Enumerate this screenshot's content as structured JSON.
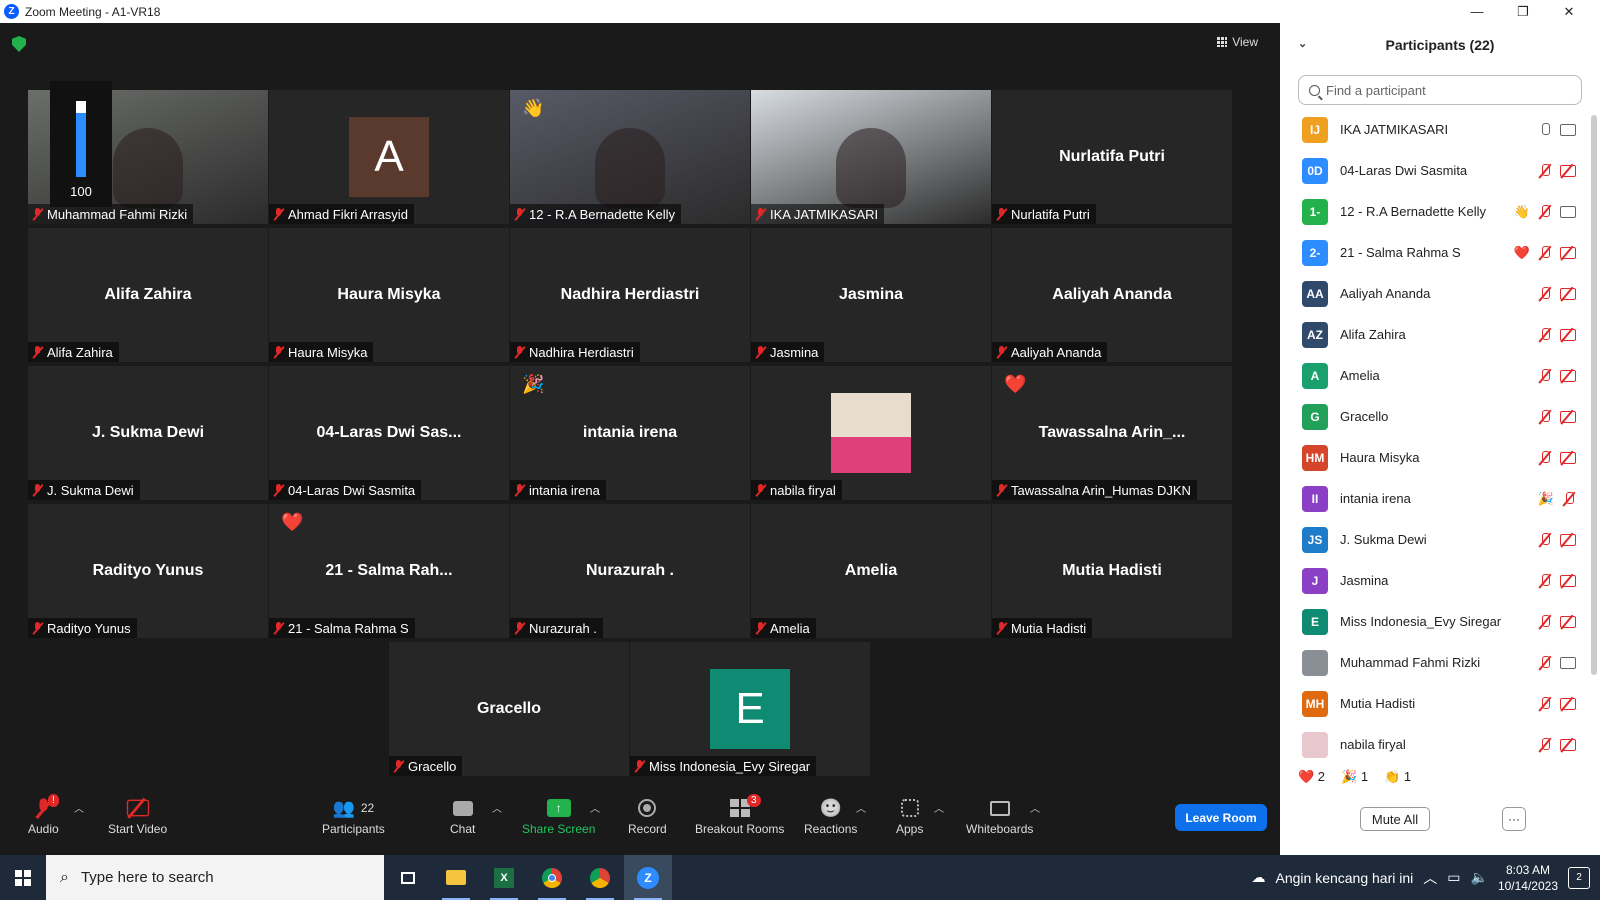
{
  "window": {
    "title": "Zoom Meeting - A1-VR18",
    "logo_letter": "Z"
  },
  "meeting": {
    "view_label": "View",
    "volume_level": "100",
    "tiles": [
      {
        "big": "",
        "label": "Muhammad Fahmi Rizki",
        "kind": "video",
        "bg": "#6b6e6a"
      },
      {
        "big": "A",
        "label": "Ahmad Fikri Arrasyid",
        "kind": "avatar",
        "bg": "#5b3a2e"
      },
      {
        "big": "",
        "label": "12 - R.A Bernadette Kelly",
        "kind": "video",
        "bg": "#585a66",
        "reaction": "👋"
      },
      {
        "big": "",
        "label": "IKA JATMIKASARI",
        "kind": "video",
        "bg": "#d8dde2",
        "active": true
      },
      {
        "big": "Nurlatifa Putri",
        "label": "Nurlatifa Putri",
        "kind": "name"
      },
      {
        "big": "Alifa Zahira",
        "label": "Alifa Zahira",
        "kind": "name"
      },
      {
        "big": "Haura Misyka",
        "label": "Haura Misyka",
        "kind": "name"
      },
      {
        "big": "Nadhira Herdiastri",
        "label": "Nadhira Herdiastri",
        "kind": "name"
      },
      {
        "big": "Jasmina",
        "label": "Jasmina",
        "kind": "name"
      },
      {
        "big": "Aaliyah Ananda",
        "label": "Aaliyah Ananda",
        "kind": "name"
      },
      {
        "big": "J. Sukma Dewi",
        "label": "J. Sukma Dewi",
        "kind": "name"
      },
      {
        "big": "04-Laras Dwi Sas...",
        "label": "04-Laras Dwi Sasmita",
        "kind": "name"
      },
      {
        "big": "intania irena",
        "label": "intania irena",
        "kind": "name",
        "reaction": "🎉"
      },
      {
        "big": "",
        "label": "nabila firyal",
        "kind": "photo"
      },
      {
        "big": "Tawassalna  Arin_...",
        "label": "Tawassalna Arin_Humas DJKN",
        "kind": "name",
        "reaction": "❤️"
      },
      {
        "big": "Radityo Yunus",
        "label": "Radityo Yunus",
        "kind": "name"
      },
      {
        "big": "21  - Salma Rah...",
        "label": "21 - Salma Rahma S",
        "kind": "name",
        "reaction": "❤️"
      },
      {
        "big": "Nurazurah .",
        "label": "Nurazurah .",
        "kind": "name"
      },
      {
        "big": "Amelia",
        "label": "Amelia",
        "kind": "name"
      },
      {
        "big": "Mutia Hadisti",
        "label": "Mutia Hadisti",
        "kind": "name"
      },
      {
        "big": "Gracello",
        "label": "Gracello",
        "kind": "name"
      },
      {
        "big": "E",
        "label": "Miss Indonesia_Evy Siregar",
        "kind": "avatar",
        "bg": "#0f8a73"
      }
    ]
  },
  "toolbar": {
    "audio": "Audio",
    "audio_badge": "!",
    "start_video": "Start Video",
    "participants": "Participants",
    "participants_count": "22",
    "chat": "Chat",
    "share_screen": "Share Screen",
    "record": "Record",
    "breakout_rooms": "Breakout Rooms",
    "breakout_badge": "3",
    "reactions": "Reactions",
    "apps": "Apps",
    "whiteboards": "Whiteboards",
    "leave": "Leave Room"
  },
  "panel": {
    "title": "Participants (22)",
    "search_placeholder": "Find a participant",
    "participants": [
      {
        "initials": "IJ",
        "name": "IKA JATMIKASARI",
        "color": "#f0a020",
        "mic": "on",
        "cam": "on"
      },
      {
        "initials": "0D",
        "name": "04-Laras Dwi Sasmita",
        "color": "#2d8cff",
        "mic": "off",
        "cam": "off"
      },
      {
        "initials": "1-",
        "name": "12 - R.A Bernadette Kelly",
        "color": "#22b14c",
        "mic": "off",
        "cam": "on",
        "reaction": "👋"
      },
      {
        "initials": "2-",
        "name": "21 - Salma Rahma S",
        "color": "#2d8cff",
        "mic": "off",
        "cam": "off",
        "reaction": "❤️"
      },
      {
        "initials": "AA",
        "name": "Aaliyah Ananda",
        "color": "#2f4a6b",
        "mic": "off",
        "cam": "off"
      },
      {
        "initials": "AZ",
        "name": "Alifa Zahira",
        "color": "#2f4a6b",
        "mic": "off",
        "cam": "off"
      },
      {
        "initials": "A",
        "name": "Amelia",
        "color": "#1aa06e",
        "mic": "off",
        "cam": "off"
      },
      {
        "initials": "G",
        "name": "Gracello",
        "color": "#22a05a",
        "mic": "off",
        "cam": "off"
      },
      {
        "initials": "HM",
        "name": "Haura Misyka",
        "color": "#d4452a",
        "mic": "off",
        "cam": "off"
      },
      {
        "initials": "II",
        "name": "intania irena",
        "color": "#8a3fc4",
        "mic": "off",
        "cam": "none",
        "reaction": "🎉"
      },
      {
        "initials": "JS",
        "name": "J. Sukma Dewi",
        "color": "#1e7cc8",
        "mic": "off",
        "cam": "off"
      },
      {
        "initials": "J",
        "name": "Jasmina",
        "color": "#8a3fc4",
        "mic": "off",
        "cam": "off"
      },
      {
        "initials": "E",
        "name": "Miss Indonesia_Evy Siregar",
        "color": "#0f8a73",
        "mic": "off",
        "cam": "off"
      },
      {
        "initials": "",
        "name": "Muhammad Fahmi Rizki",
        "color": "#8a8f96",
        "mic": "off",
        "cam": "on"
      },
      {
        "initials": "MH",
        "name": "Mutia Hadisti",
        "color": "#e06a10",
        "mic": "off",
        "cam": "off"
      },
      {
        "initials": "",
        "name": "nabila firyal",
        "color": "#e9c7cf",
        "mic": "off",
        "cam": "off"
      }
    ],
    "reaction_counts": [
      {
        "icon": "❤️",
        "count": "2"
      },
      {
        "icon": "🎉",
        "count": "1"
      },
      {
        "icon": "👏",
        "count": "1"
      }
    ],
    "mute_all": "Mute All",
    "more": "···"
  },
  "taskbar": {
    "search_placeholder": "Type here to search",
    "weather": "Angin kencang hari ini",
    "time": "8:03 AM",
    "date": "10/14/2023",
    "notif_count": "2"
  }
}
